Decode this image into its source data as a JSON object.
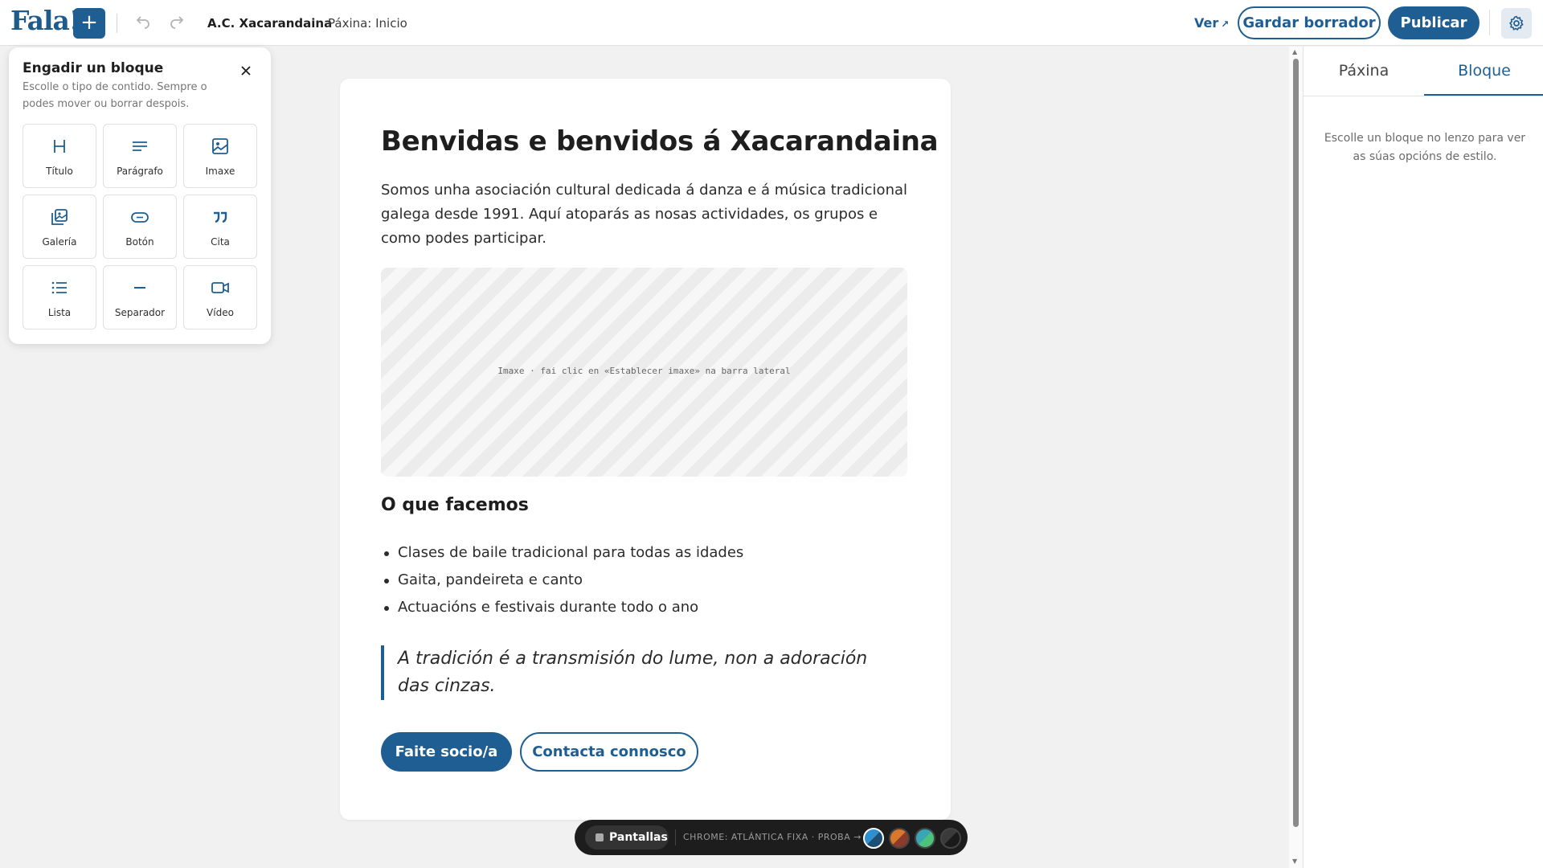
{
  "topbar": {
    "logo": "Fala!",
    "add_label": "+",
    "site_name": "A.C. Xacarandaina",
    "separator": "·",
    "page_label": "Páxina: Inicio",
    "view_label": "Ver",
    "view_arrow": "↗",
    "save_draft_label": "Gardar borrador",
    "publish_label": "Publicar"
  },
  "inserter": {
    "title": "Engadir un bloque",
    "description": "Escolle o tipo de contido. Sempre o podes mover ou borrar despois.",
    "blocks": [
      {
        "label": "Título",
        "icon": "heading-icon"
      },
      {
        "label": "Parágrafo",
        "icon": "paragraph-icon"
      },
      {
        "label": "Imaxe",
        "icon": "image-icon"
      },
      {
        "label": "Galería",
        "icon": "gallery-icon"
      },
      {
        "label": "Botón",
        "icon": "button-icon"
      },
      {
        "label": "Cita",
        "icon": "quote-icon"
      },
      {
        "label": "Lista",
        "icon": "list-icon"
      },
      {
        "label": "Separador",
        "icon": "separator-icon"
      },
      {
        "label": "Vídeo",
        "icon": "video-icon"
      }
    ]
  },
  "document": {
    "heading": "Benvidas e benvidos á Xacarandaina",
    "paragraph": "Somos unha asociación cultural dedicada á danza e á música tradicional galega desde 1991. Aquí atoparás as nosas actividades, os grupos e como podes participar.",
    "image_placeholder": "Imaxe · fai clic en «Establecer imaxe» na barra lateral",
    "subheading": "O que facemos",
    "list": [
      "Clases de baile tradicional para todas as idades",
      "Gaita, pandeireta e canto",
      "Actuacións e festivais durante todo o ano"
    ],
    "quote": "A tradición é a transmisión do lume, non a adoración das cinzas.",
    "primary_button": "Faite socio/a",
    "secondary_button": "Contacta connosco"
  },
  "bottombar": {
    "screens_label": "Pantallas",
    "chrome_label": "CHROME: ATLÁNTICA FIXA · PROBA →",
    "swatches": [
      "#2f8fcf",
      "#d9772b",
      "#3aa5b5",
      "#3a3a3a"
    ]
  },
  "rightpanel": {
    "tabs": [
      "Páxina",
      "Bloque"
    ],
    "active_tab": "Bloque",
    "hint": "Escolle un bloque no lenzo para ver as súas opcións de estilo."
  },
  "colors": {
    "accent": "#1f5e92",
    "canvas_bg": "#f1f1f1"
  }
}
